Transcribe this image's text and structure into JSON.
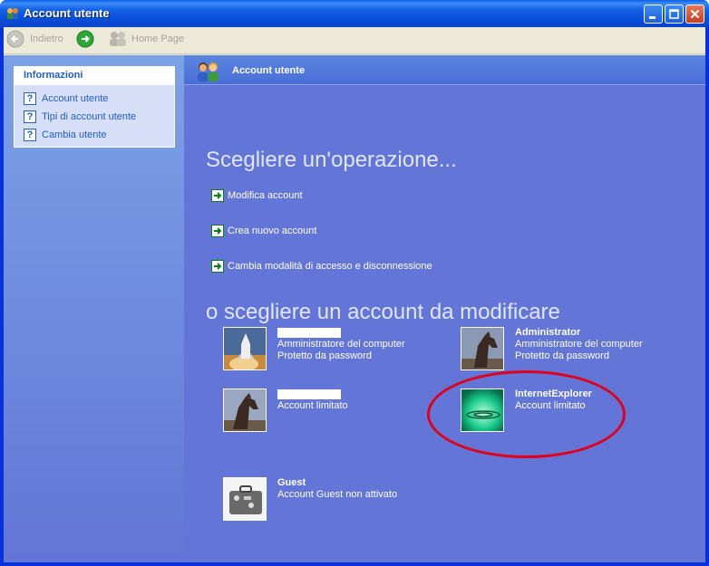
{
  "window": {
    "title": "Account utente",
    "colors": {
      "titlebar": "#0a4fd8",
      "panel": "#6375d6",
      "highlight": "#e1001c"
    }
  },
  "toolbar": {
    "back_label": "Indietro",
    "home_label": "Home Page"
  },
  "sidebar": {
    "heading": "Informazioni",
    "items": [
      {
        "label": "Account utente",
        "icon": "help-icon"
      },
      {
        "label": "Tipi di account utente",
        "icon": "help-icon"
      },
      {
        "label": "Cambia utente",
        "icon": "help-icon"
      }
    ]
  },
  "main": {
    "header_title": "Account utente",
    "task_heading": "Scegliere un'operazione...",
    "tasks": [
      "Modifica account",
      "Crea nuovo account",
      "Cambia modalità di accesso e disconnessione"
    ],
    "account_heading": "o scegliere un account da modificare",
    "accounts": [
      {
        "name": "",
        "line1": "Amministratore del computer",
        "line2": "Protetto da password",
        "picture": "space-shuttle"
      },
      {
        "name": "Administrator",
        "line1": "Amministratore del computer",
        "line2": "Protetto da password",
        "picture": "horse"
      },
      {
        "name": "",
        "line1": "Account limitato",
        "line2": "",
        "picture": "horse"
      },
      {
        "name": "InternetExplorer",
        "line1": "Account limitato",
        "line2": "",
        "picture": "green-ripple"
      },
      {
        "name": "Guest",
        "line1": "Account Guest non attivato",
        "line2": "",
        "picture": "suitcase"
      }
    ]
  }
}
